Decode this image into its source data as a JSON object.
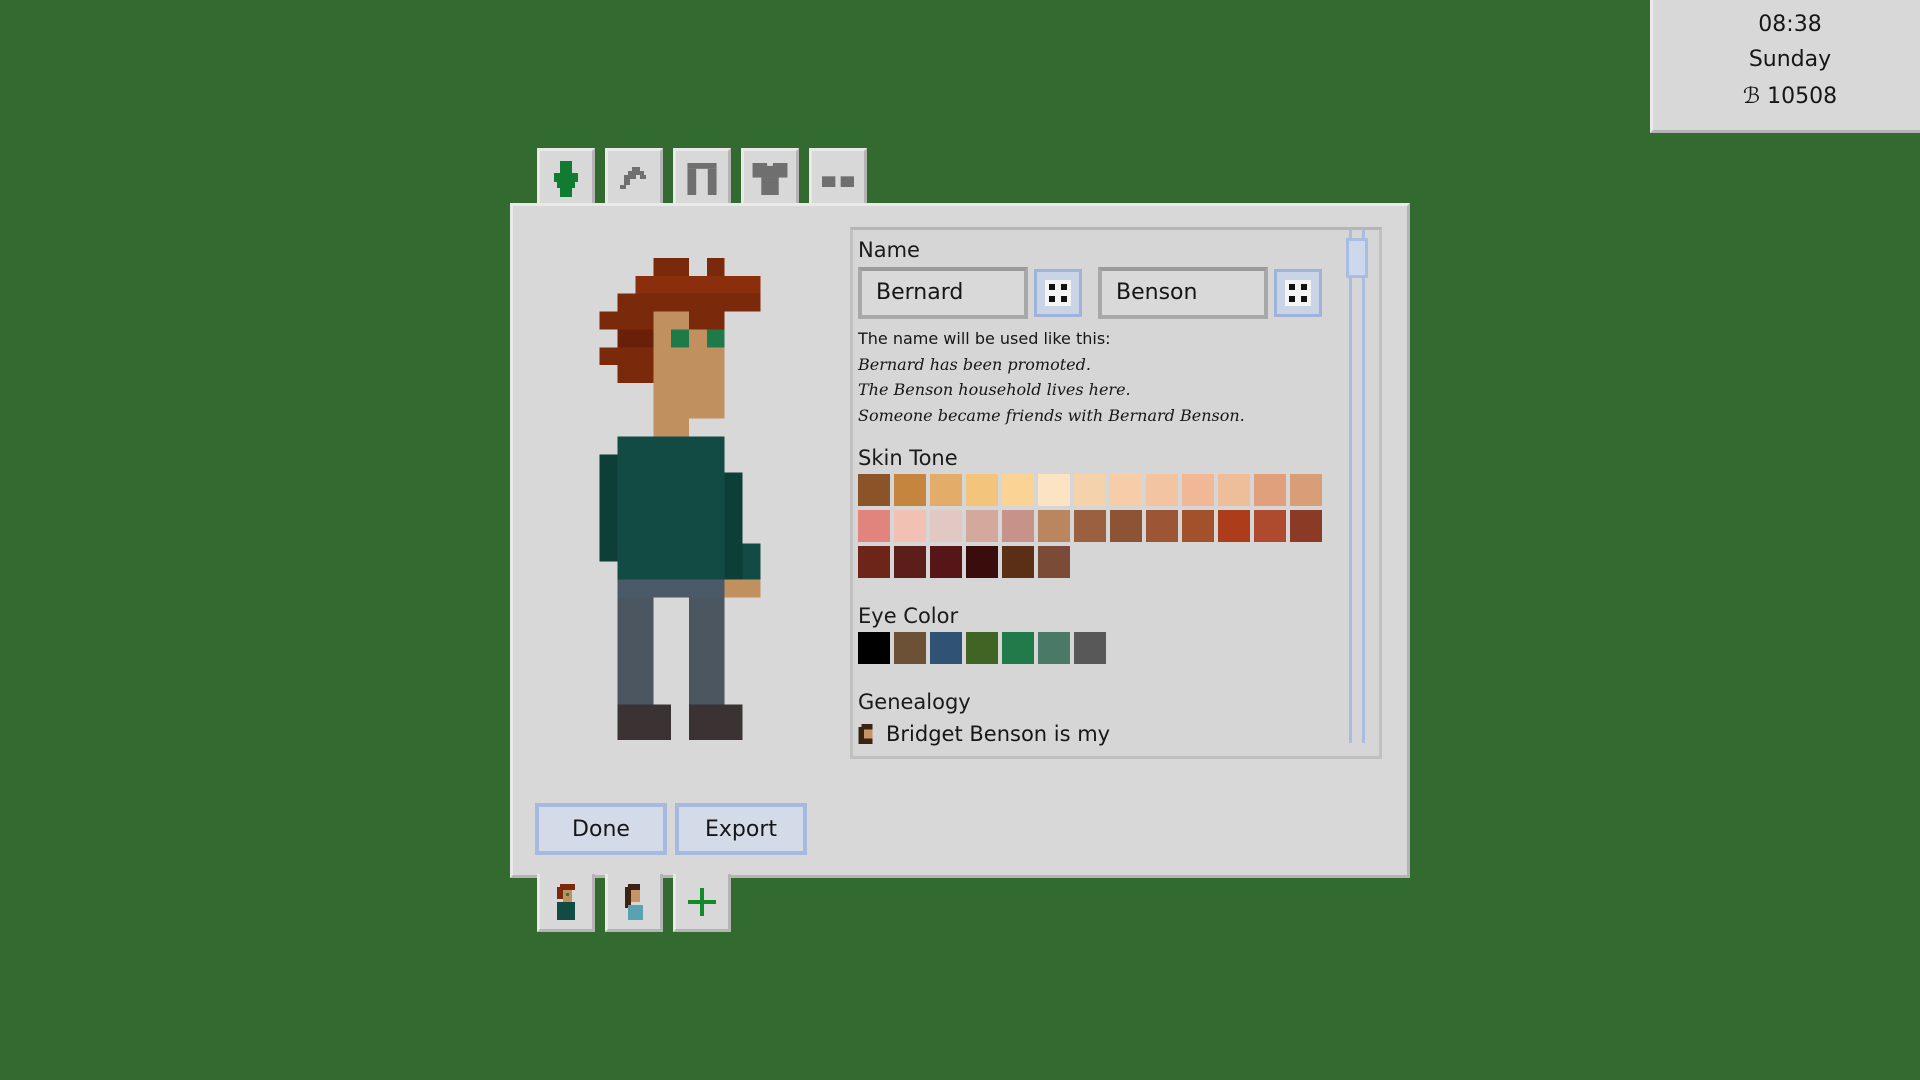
{
  "clock": {
    "time": "08:38",
    "day": "Sunday",
    "money": "ℬ 10508"
  },
  "tabs": [
    {
      "icon": "body-icon",
      "active": true
    },
    {
      "icon": "hair-icon"
    },
    {
      "icon": "pants-icon"
    },
    {
      "icon": "shirt-icon"
    },
    {
      "icon": "shoes-icon"
    }
  ],
  "editor": {
    "name_heading": "Name",
    "first_name": "Bernard",
    "last_name": "Benson",
    "name_usage": {
      "intro": "The name will be used like this:",
      "line1": "Bernard has been promoted.",
      "line2": "The Benson household lives here.",
      "line3": "Someone became friends with Bernard Benson."
    },
    "skin_heading": "Skin Tone",
    "skin_rows": [
      [
        "#8b5428",
        "#c5853f",
        "#e3ad69",
        "#f3c47b",
        "#fbd395",
        "#fbe3c4",
        "#f4d2ac",
        "#f6cda8",
        "#f2c4a1",
        "#f1b898",
        "#eebe9b",
        "#e0a07c",
        "#d89e78"
      ],
      [
        "#e0847d",
        "#f1c1b4",
        "#e1c8c3",
        "#d3a99d",
        "#c6928a",
        "#b98660",
        "#9a6040",
        "#8c5435",
        "#9c5636",
        "#a2512c",
        "#ad3d1a",
        "#ae4b2e",
        "#8b3a26"
      ],
      [
        "#6e2519",
        "#5c1e18",
        "#561516",
        "#380d0c",
        "#5a2f15",
        "#7a4b36"
      ]
    ],
    "eye_heading": "Eye Color",
    "eye_colors": [
      "#000000",
      "#6c5137",
      "#2f5275",
      "#3f6424",
      "#207a49",
      "#4a7a67",
      "#585858"
    ],
    "genealogy_heading": "Genealogy",
    "genealogy_first": "Bridget Benson is my"
  },
  "buttons": {
    "done": "Done",
    "export": "Export"
  },
  "household": [
    {
      "icon": "bernard-portrait-icon"
    },
    {
      "icon": "bridget-portrait-icon"
    },
    {
      "icon": "add-member-icon"
    }
  ]
}
